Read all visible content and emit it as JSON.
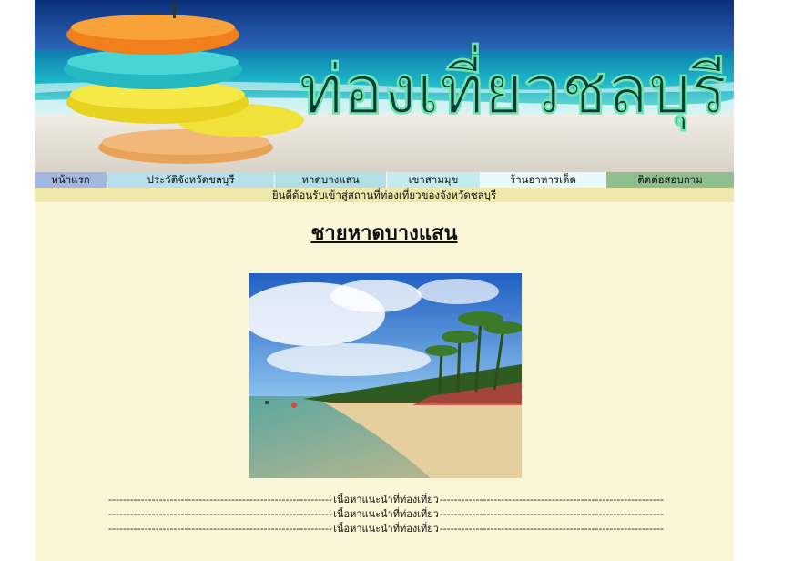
{
  "banner": {
    "title": "ท่องเที่ยวชลบุรี"
  },
  "nav": [
    {
      "label": "หน้าแรก",
      "color": "#a3b8e0"
    },
    {
      "label": "ประวัติจังหวัดชลบุรี",
      "color": "#b7e0ec"
    },
    {
      "label": "หาดบางแสน",
      "color": "#b0dfe5"
    },
    {
      "label": "เขาสามมุข",
      "color": "#c2ecf0"
    },
    {
      "label": "ร้านอาหารเด็ด",
      "color": "#e8f9fb"
    },
    {
      "label": "ติดต่อสอบถาม",
      "color": "#8fbf8f"
    }
  ],
  "marquee": "ยินดีต้อนรับเข้าสู่สถานที่ท่องเที่ยวของจังหวัดชลบุรี",
  "content": {
    "heading": "ชายหาดบางแสน",
    "lines": [
      "เนื้อหาแนะนำที่ท่องเที่ยว",
      "เนื้อหาแนะนำที่ท่องเที่ยว",
      "เนื้อหาแนะนำที่ท่องเที่ยว"
    ]
  },
  "colors": {
    "page_bg": "#fcf6d8",
    "marquee_bg": "#eee8aa"
  }
}
